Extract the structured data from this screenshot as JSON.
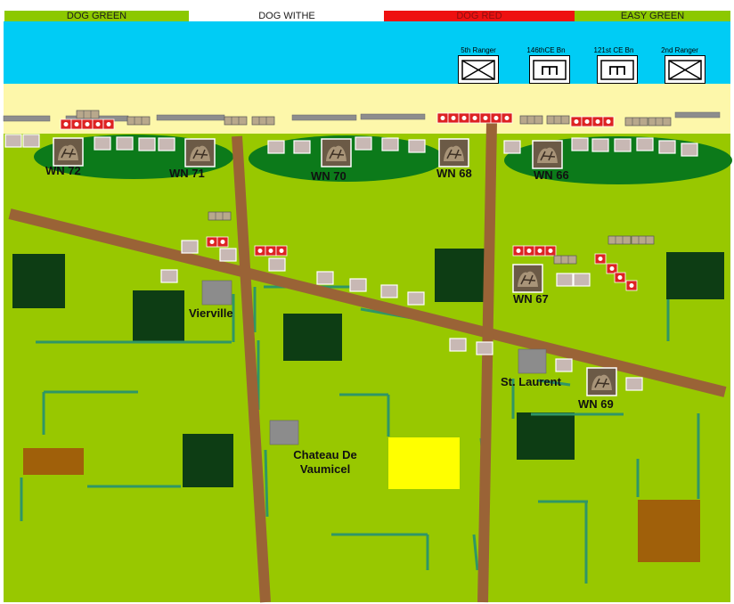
{
  "sectors": [
    {
      "label": "DOG GREEN",
      "color": "#8cc800",
      "text_color": "#1a1a1a"
    },
    {
      "label": "DOG  WITHE",
      "color": "#ffffff",
      "text_color": "#1a1a1a"
    },
    {
      "label": "DOG  RED",
      "color": "#ee1111",
      "text_color": "#8a1010"
    },
    {
      "label": "EASY GREEN",
      "color": "#8cc800",
      "text_color": "#1a1a1a"
    }
  ],
  "units": [
    {
      "label": "5th Ranger",
      "symbol": "infantry"
    },
    {
      "label": "146thCE Bn",
      "symbol": "engineer"
    },
    {
      "label": "121st CE Bn",
      "symbol": "engineer"
    },
    {
      "label": "2nd Ranger",
      "symbol": "infantry"
    }
  ],
  "strongpoints": [
    "WN 72",
    "WN 71",
    "WN 70",
    "WN 68",
    "WN 66",
    "WN 67",
    "WN 69"
  ],
  "places": {
    "vierville": "Vierville",
    "st_laurent": "St. Laurent",
    "chateau_line1": "Chateau De",
    "chateau_line2": "Vaumicel"
  },
  "colors": {
    "sea": "#00ccf5",
    "beach": "#fdf7aa",
    "grass": "#98c800",
    "road": "#9a6336",
    "woods": "#0d3d14",
    "hedge": "#2f9666",
    "village": "#8c8c8c",
    "bluff": "#0c7a1a",
    "mine_red": "#dd2222",
    "orchard": "#a0600a",
    "field_yellow": "#ffff00"
  },
  "icons": [
    "bunker-icon",
    "crate-icon",
    "mine-icon",
    "sandbag-icon",
    "barbed-wire-icon"
  ]
}
